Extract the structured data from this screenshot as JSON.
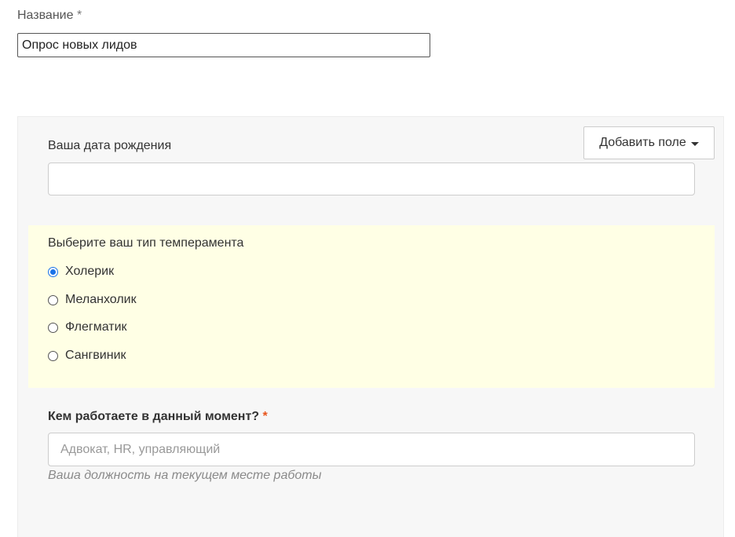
{
  "name_field": {
    "label": "Название",
    "required_mark": "*",
    "value": "Опрос новых лидов"
  },
  "toolbar": {
    "add_field_label": "Добавить поле",
    "add_field_icon": "caret-down-icon"
  },
  "fields": {
    "birth_date": {
      "label": "Ваша дата рождения",
      "value": ""
    },
    "temperament": {
      "label": "Выберите ваш тип темперамента",
      "highlight_color": "#ffffe5",
      "options": [
        {
          "label": "Холерик",
          "checked": true
        },
        {
          "label": "Меланхолик",
          "checked": false
        },
        {
          "label": "Флегматик",
          "checked": false
        },
        {
          "label": "Сангвиник",
          "checked": false
        }
      ]
    },
    "job": {
      "label": "Кем работаете в данный момент?",
      "required_mark": "*",
      "placeholder": "Адвокат, HR, управляющий",
      "help_text": "Ваша должность на текущем месте работы"
    }
  },
  "colors": {
    "accent": "#1a73e8",
    "required": "#e8541c",
    "panel_bg": "#f7f7f7"
  }
}
